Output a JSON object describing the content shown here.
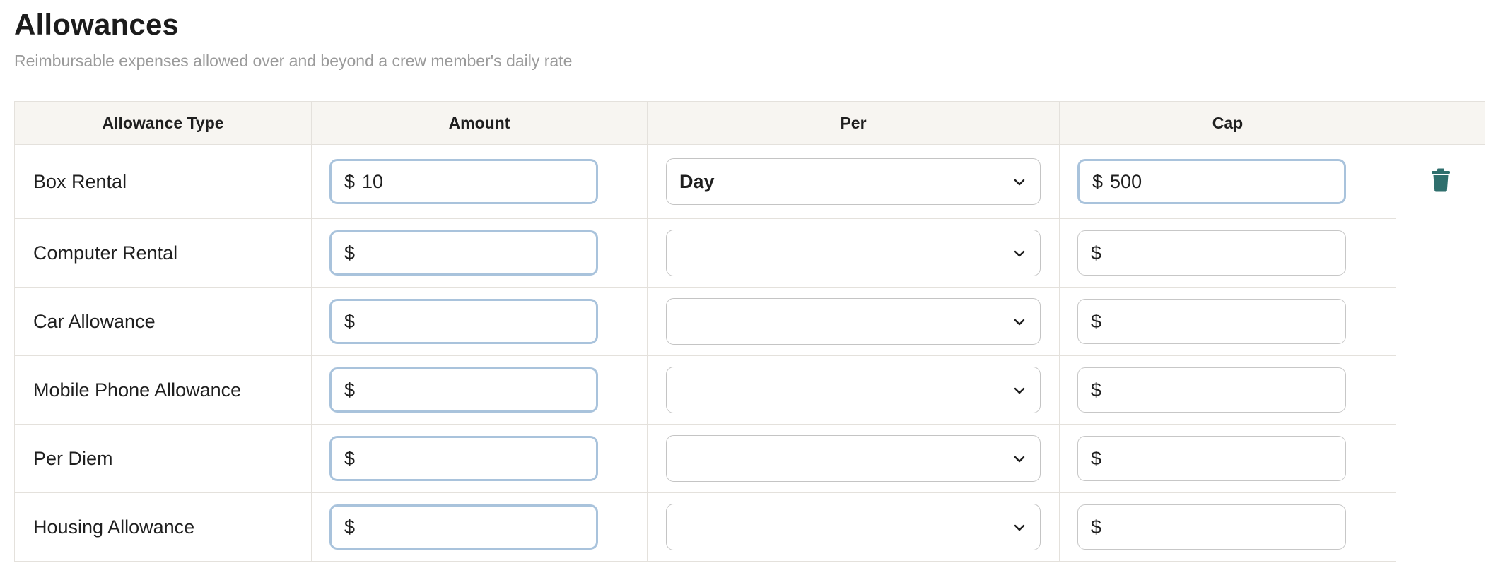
{
  "header": {
    "title": "Allowances",
    "subtitle": "Reimbursable expenses allowed over and beyond a crew member's daily rate"
  },
  "table": {
    "columns": [
      "Allowance Type",
      "Amount",
      "Per",
      "Cap"
    ],
    "rows": [
      {
        "type": "Box Rental",
        "amount": "10",
        "per": "Day",
        "cap": "500"
      },
      {
        "type": "Computer Rental",
        "amount": "",
        "per": "",
        "cap": ""
      },
      {
        "type": "Car Allowance",
        "amount": "",
        "per": "",
        "cap": ""
      },
      {
        "type": "Mobile Phone Allowance",
        "amount": "",
        "per": "",
        "cap": ""
      },
      {
        "type": "Per Diem",
        "amount": "",
        "per": "",
        "cap": ""
      },
      {
        "type": "Housing Allowance",
        "amount": "",
        "per": "",
        "cap": ""
      }
    ]
  },
  "currency_symbol": "$",
  "icons": {
    "row_action": "trash-icon",
    "select_arrow": "chevron-down-icon"
  },
  "colors": {
    "accent": "#2f6f6d",
    "focus_border": "#a9c3dc",
    "header_bg": "#f7f5f1"
  }
}
